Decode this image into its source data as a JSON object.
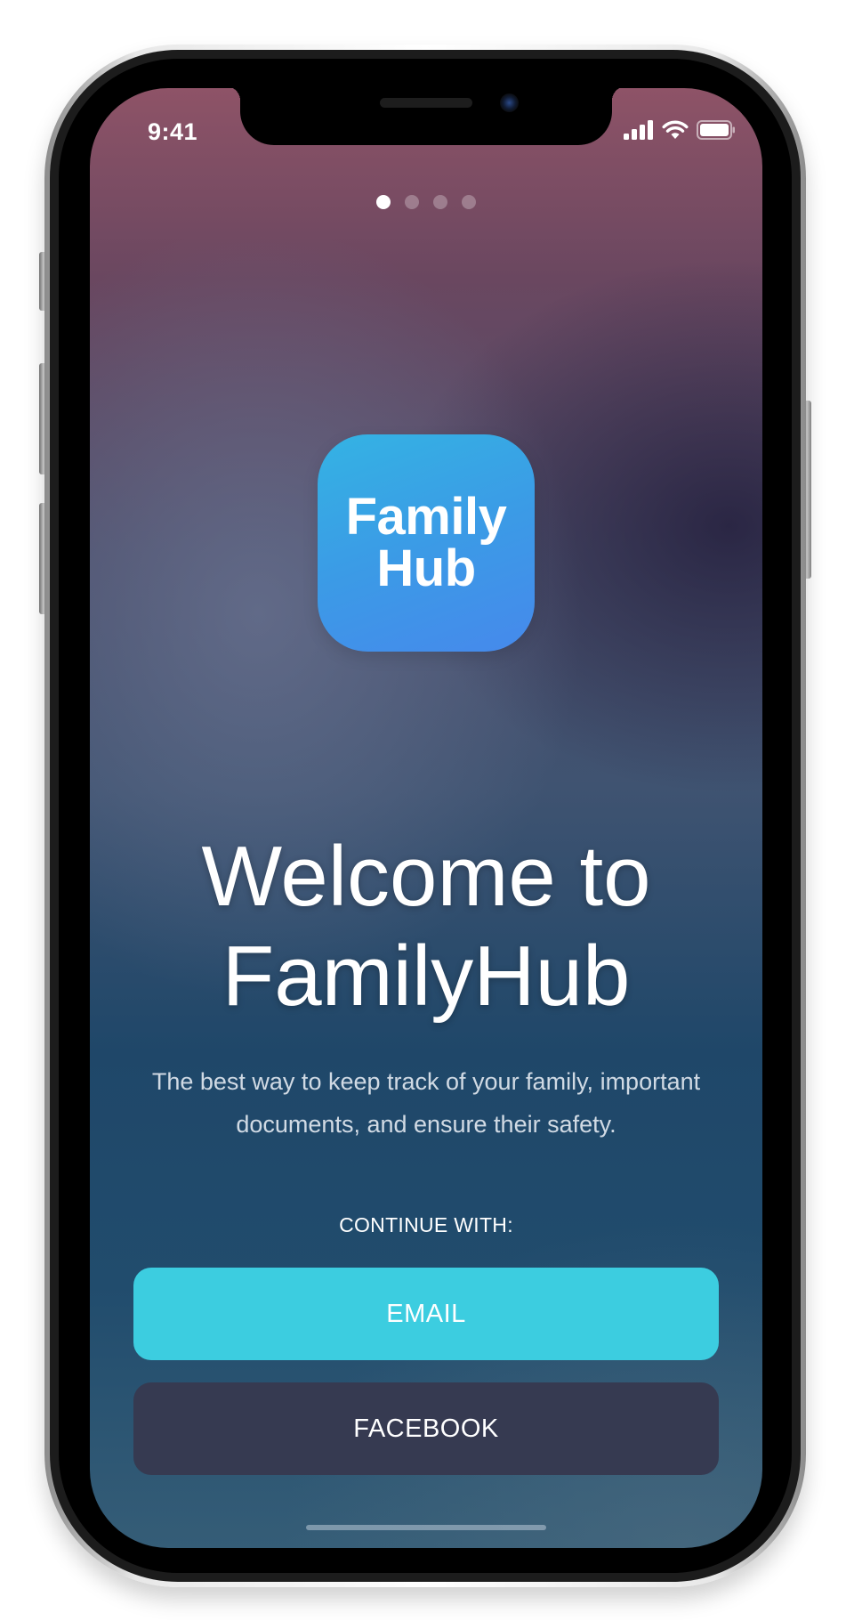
{
  "status_bar": {
    "time": "9:41",
    "icons": [
      "cellular-signal-icon",
      "wifi-icon",
      "battery-icon"
    ]
  },
  "onboarding": {
    "page_count": 4,
    "active_page": 1
  },
  "app_icon": {
    "line1": "Family",
    "line2": "Hub",
    "gradient_colors": [
      "#34b3e3",
      "#4689ec"
    ]
  },
  "welcome": {
    "title_line1": "Welcome to",
    "title_line2": "FamilyHub",
    "subtitle": "The best way to keep track of your family, important documents, and ensure their safety."
  },
  "auth": {
    "continue_label": "CONTINUE WITH:",
    "email_label": "EMAIL",
    "facebook_label": "FACEBOOK"
  },
  "colors": {
    "email_button": "#3ccde0",
    "facebook_button": "#363a51",
    "text": "#ffffff"
  }
}
